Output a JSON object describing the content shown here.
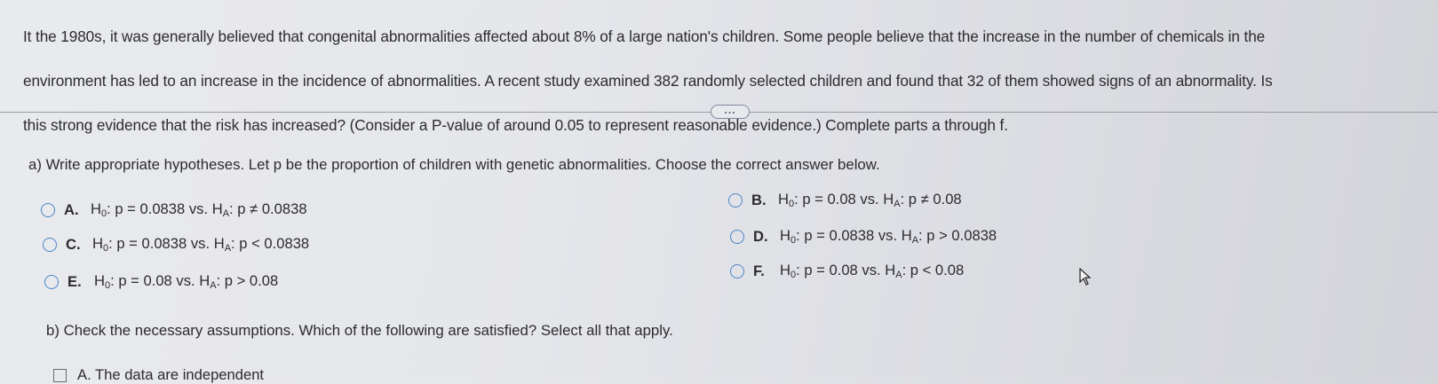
{
  "intro": {
    "line1": "It the 1980s, it was generally believed that congenital abnormalities affected about 8% of a large nation's children. Some people believe that the increase in the number of chemicals in the",
    "line2": "environment has led to an increase in the incidence of abnormalities. A recent study examined 382 randomly selected children and found that 32 of them showed signs of an abnormality. Is",
    "line3": "this strong evidence that the risk has increased? (Consider a P-value of around 0.05 to represent reasonable evidence.) Complete parts a through f."
  },
  "expand_button": {
    "label": "..."
  },
  "part_a": {
    "question": "a) Write appropriate hypotheses. Let p be the proportion of children with genetic abnormalities. Choose the correct answer below.",
    "options": [
      {
        "letter": "A.",
        "h0": "p = 0.0838",
        "sep": "vs.",
        "ha": "p ≠ 0.0838"
      },
      {
        "letter": "B.",
        "h0": "p = 0.08",
        "sep": "vs.",
        "ha": "p ≠ 0.08"
      },
      {
        "letter": "C.",
        "h0": "p = 0.0838",
        "sep": "vs.",
        "ha": "p < 0.0838"
      },
      {
        "letter": "D.",
        "h0": "p = 0.0838",
        "sep": "vs.",
        "ha": "p > 0.0838"
      },
      {
        "letter": "E.",
        "h0": "p = 0.08",
        "sep": "vs.",
        "ha": "p > 0.08"
      },
      {
        "letter": "F.",
        "h0": "p = 0.08",
        "sep": "vs.",
        "ha": "p < 0.08"
      }
    ]
  },
  "part_b": {
    "question": "b) Check the necessary assumptions. Which of the following are satisfied? Select all that apply.",
    "first_option_partial": "A.  The data are independent"
  },
  "colors": {
    "radio_border": "#4a86c8",
    "text": "#2c2c30",
    "divider": "#9a9ba1"
  }
}
